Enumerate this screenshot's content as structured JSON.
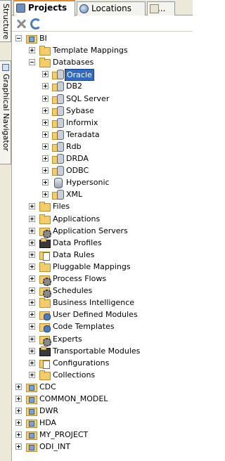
{
  "side_tabs": {
    "structure": "Structure",
    "graphical_navigator": "Graphical Navigator"
  },
  "tabs": {
    "projects": "Projects",
    "locations": "Locations",
    "extra": "..."
  },
  "tree": [
    {
      "label": "BI",
      "expanded": true,
      "icon": "project-icon",
      "level": 0
    },
    {
      "label": "Template Mappings",
      "expanded": false,
      "icon": "folder-icon",
      "level": 1
    },
    {
      "label": "Databases",
      "expanded": true,
      "icon": "folder-icon",
      "level": 1
    },
    {
      "label": "Oracle",
      "expanded": false,
      "icon": "database-folder-icon",
      "level": 2,
      "selected": true
    },
    {
      "label": "DB2",
      "expanded": false,
      "icon": "database-folder-icon",
      "level": 2
    },
    {
      "label": "SQL Server",
      "expanded": false,
      "icon": "database-folder-icon",
      "level": 2
    },
    {
      "label": "Sybase",
      "expanded": false,
      "icon": "database-folder-icon",
      "level": 2
    },
    {
      "label": "Informix",
      "expanded": false,
      "icon": "database-folder-icon",
      "level": 2
    },
    {
      "label": "Teradata",
      "expanded": false,
      "icon": "database-folder-icon",
      "level": 2
    },
    {
      "label": "Rdb",
      "expanded": false,
      "icon": "database-folder-icon",
      "level": 2
    },
    {
      "label": "DRDA",
      "expanded": false,
      "icon": "database-folder-icon",
      "level": 2
    },
    {
      "label": "ODBC",
      "expanded": false,
      "icon": "database-folder-icon",
      "level": 2
    },
    {
      "label": "Hypersonic",
      "expanded": false,
      "icon": "database-icon",
      "level": 2
    },
    {
      "label": "XML",
      "expanded": false,
      "icon": "database-folder-icon",
      "level": 2
    },
    {
      "label": "Files",
      "expanded": false,
      "icon": "folder-icon",
      "level": 1
    },
    {
      "label": "Applications",
      "expanded": false,
      "icon": "folder-icon",
      "level": 1
    },
    {
      "label": "Application Servers",
      "expanded": false,
      "icon": "gear-folder-icon",
      "level": 1
    },
    {
      "label": "Data Profiles",
      "expanded": false,
      "icon": "dark-folder-icon",
      "level": 1
    },
    {
      "label": "Data Rules",
      "expanded": false,
      "icon": "document-folder-icon",
      "level": 1
    },
    {
      "label": "Pluggable Mappings",
      "expanded": false,
      "icon": "folder-icon",
      "level": 1
    },
    {
      "label": "Process Flows",
      "expanded": false,
      "icon": "gear-folder-icon",
      "level": 1
    },
    {
      "label": "Schedules",
      "expanded": false,
      "icon": "gear-folder-icon",
      "level": 1
    },
    {
      "label": "Business Intelligence",
      "expanded": false,
      "icon": "folder-icon",
      "level": 1
    },
    {
      "label": "User Defined Modules",
      "expanded": false,
      "icon": "blue-folder-icon",
      "level": 1
    },
    {
      "label": "Code Templates",
      "expanded": false,
      "icon": "blue-folder-icon",
      "level": 1
    },
    {
      "label": "Experts",
      "expanded": false,
      "icon": "gear-folder-icon",
      "level": 1
    },
    {
      "label": "Transportable Modules",
      "expanded": false,
      "icon": "dark-folder-icon",
      "level": 1
    },
    {
      "label": "Configurations",
      "expanded": false,
      "icon": "document-folder-icon",
      "level": 1
    },
    {
      "label": "Collections",
      "expanded": false,
      "icon": "folder-icon",
      "level": 1
    },
    {
      "label": "CDC",
      "expanded": false,
      "icon": "project-icon",
      "level": 0
    },
    {
      "label": "COMMON_MODEL",
      "expanded": false,
      "icon": "project-icon",
      "level": 0
    },
    {
      "label": "DWR",
      "expanded": false,
      "icon": "project-icon",
      "level": 0
    },
    {
      "label": "HDA",
      "expanded": false,
      "icon": "project-icon",
      "level": 0
    },
    {
      "label": "MY_PROJECT",
      "expanded": false,
      "icon": "project-icon",
      "level": 0
    },
    {
      "label": "ODI_INT",
      "expanded": false,
      "icon": "project-icon",
      "level": 0
    }
  ]
}
